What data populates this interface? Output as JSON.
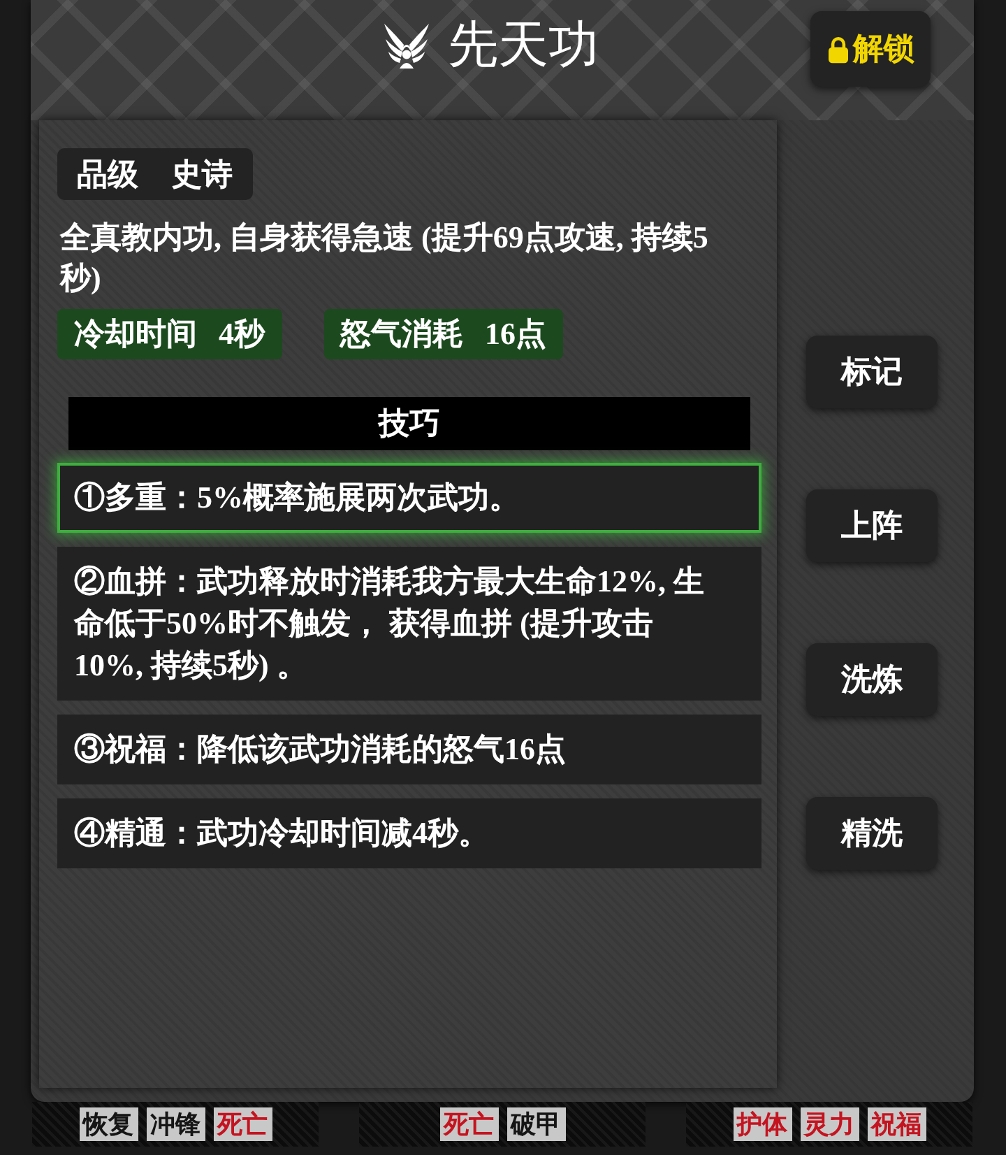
{
  "header": {
    "title": "先天功",
    "unlock_button": "解锁"
  },
  "grade": {
    "label": "品级",
    "value": "史诗"
  },
  "description": "全真教内功, 自身获得急速 (提升69点攻速, 持续5秒)",
  "stats": [
    {
      "label": "冷却时间",
      "value": "4秒"
    },
    {
      "label": "怒气消耗",
      "value": "16点"
    }
  ],
  "techniques": {
    "heading": "技巧",
    "items": [
      {
        "text": "①多重：5%概率施展两次武功。",
        "selected": true
      },
      {
        "text": "②血拼：武功释放时消耗我方最大生命12%, 生命低于50%时不触发， 获得血拼 (提升攻击10%, 持续5秒) 。",
        "selected": false
      },
      {
        "text": "③祝福：降低该武功消耗的怒气16点",
        "selected": false
      },
      {
        "text": "④精通：武功冷却时间减4秒。",
        "selected": false
      }
    ]
  },
  "actions": [
    "标记",
    "上阵",
    "洗炼",
    "精洗"
  ],
  "tag_groups": [
    {
      "tags": [
        {
          "label": "恢复",
          "color": "#151515"
        },
        {
          "label": "冲锋",
          "color": "#151515"
        },
        {
          "label": "死亡",
          "color": "#c41420"
        }
      ]
    },
    {
      "tags": [
        {
          "label": "死亡",
          "color": "#c41420"
        },
        {
          "label": "破甲",
          "color": "#151515"
        }
      ]
    },
    {
      "tags": [
        {
          "label": "护体",
          "color": "#c41420"
        },
        {
          "label": "灵力",
          "color": "#c41420"
        },
        {
          "label": "祝福",
          "color": "#c41420"
        }
      ]
    }
  ]
}
